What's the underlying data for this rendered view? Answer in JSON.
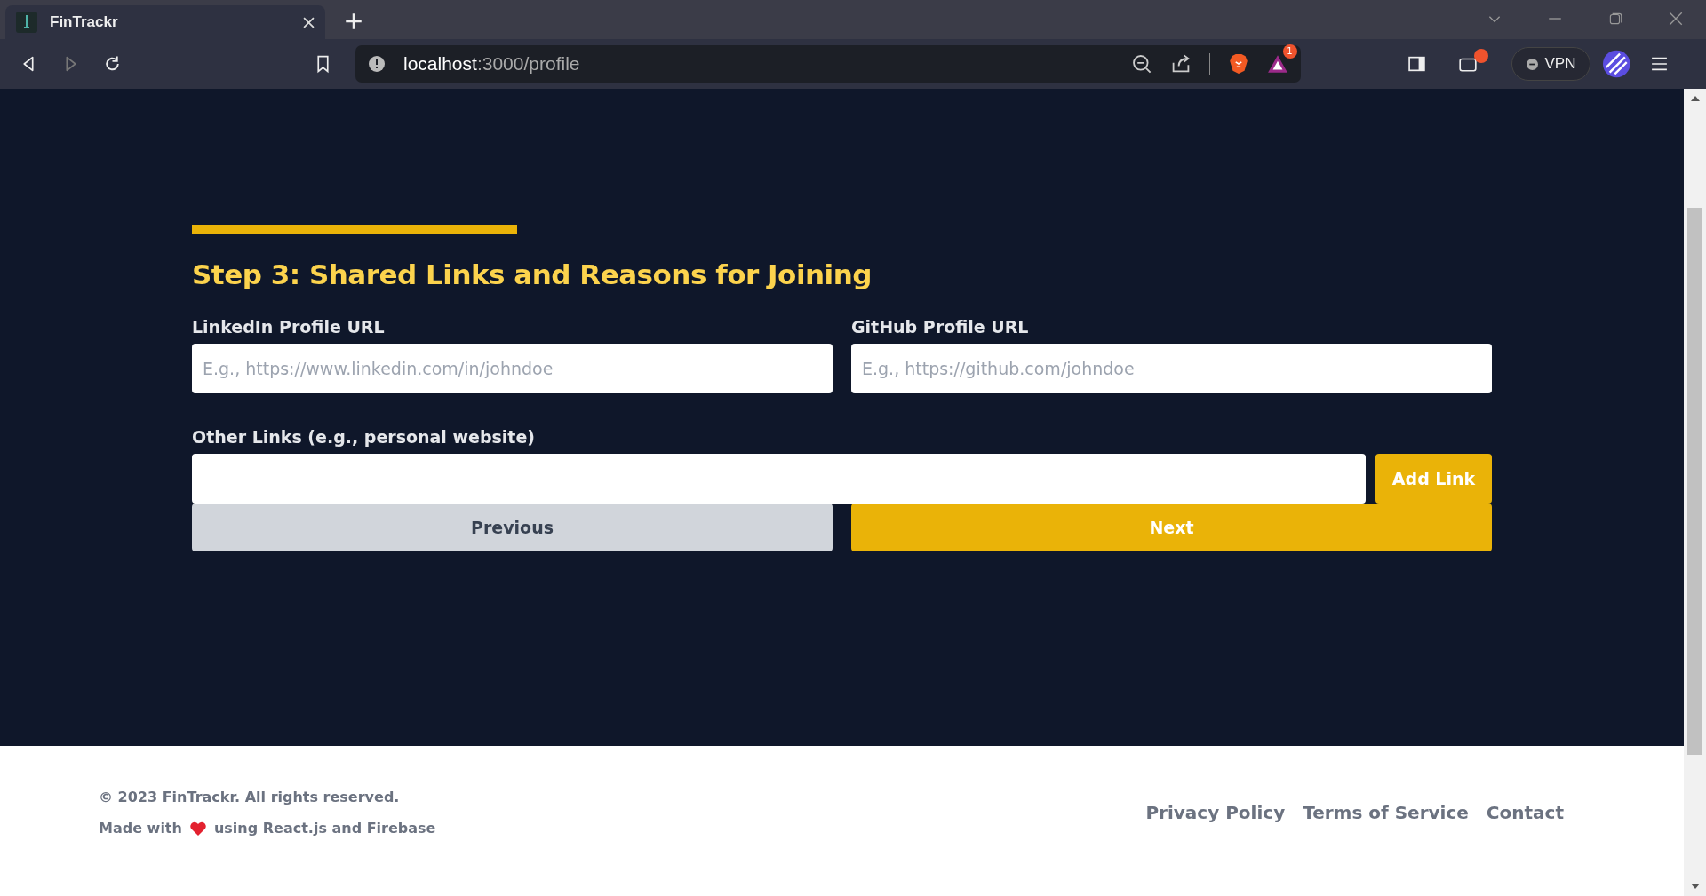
{
  "browser": {
    "tab": {
      "title": "FinTrackr",
      "selected": true
    },
    "address": {
      "host": "localhost",
      "path": ":3000/profile"
    },
    "vpn": "VPN",
    "notification_count": "1"
  },
  "form": {
    "title": "Step 3: Shared Links and Reasons for Joining",
    "fields": [
      {
        "label": "LinkedIn Profile URL",
        "placeholder": "E.g., https://www.linkedin.com/in/johndoe"
      },
      {
        "label": "GitHub Profile URL",
        "placeholder": "E.g., https://github.com/johndoe"
      }
    ],
    "other_links": {
      "label": "Other Links (e.g., personal website)",
      "button": "Add Link"
    },
    "previous": "Previous",
    "next": "Next"
  },
  "footer": {
    "copyright": "© 2023 FinTrackr. All rights reserved.",
    "made_with_before": "Made with",
    "made_with_after": "using React.js and Firebase",
    "links": [
      "Privacy Policy",
      "Terms of Service",
      "Contact"
    ]
  }
}
